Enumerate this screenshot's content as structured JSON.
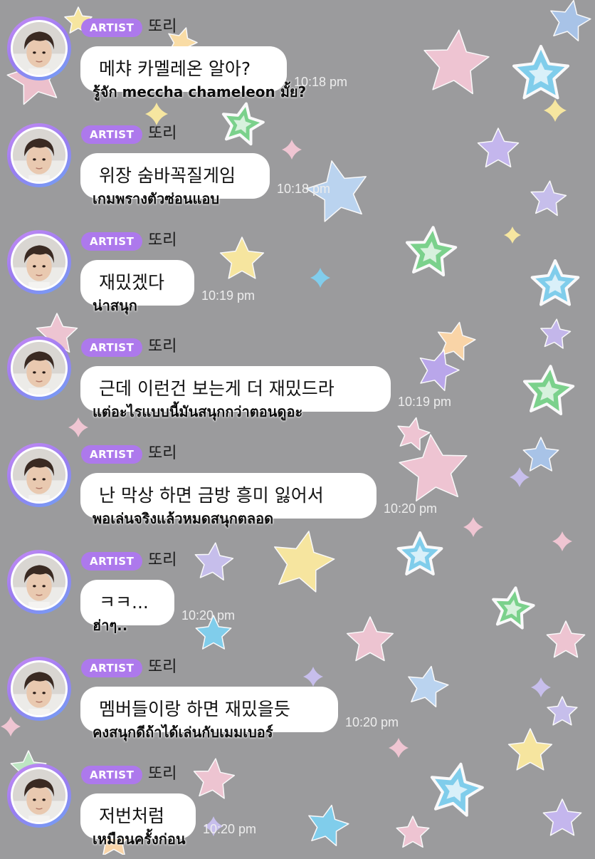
{
  "colors": {
    "background": "#9b9b9d",
    "badge": "#ad79ec",
    "bubble": "#ffffff"
  },
  "messages": [
    {
      "badge": "ARTIST",
      "sender": "또리",
      "text": "메챠 카멜레온 알아?",
      "time": "10:18 pm",
      "translation": "รู้จัก meccha chameleon มั้ย?"
    },
    {
      "badge": "ARTIST",
      "sender": "또리",
      "text": "위장 숨바꼭질게임",
      "time": "10:18 pm",
      "translation": "เกมพรางตัวซ่อนแอบ"
    },
    {
      "badge": "ARTIST",
      "sender": "또리",
      "text": "재밌겠다",
      "time": "10:19 pm",
      "translation": "น่าสนุก"
    },
    {
      "badge": "ARTIST",
      "sender": "또리",
      "text": "근데 이런건 보는게 더 재밌드라",
      "time": "10:19 pm",
      "translation": "แต่อะไรแบบนี้มันสนุกกว่าตอนดูอะ"
    },
    {
      "badge": "ARTIST",
      "sender": "또리",
      "text": "난 막상 하면 금방 흥미 잃어서",
      "time": "10:20 pm",
      "translation": "พอเล่นจริงแล้วหมดสนุกตลอด"
    },
    {
      "badge": "ARTIST",
      "sender": "또리",
      "text": "ㅋㅋ...",
      "time": "10:20 pm",
      "translation": "ฮ่าๆ.."
    },
    {
      "badge": "ARTIST",
      "sender": "또리",
      "text": "멤버들이랑 하면 재밌을듯",
      "time": "10:20 pm",
      "translation": "คงสนุกดีถ้าได้เล่นกับเมมเบอร์"
    },
    {
      "badge": "ARTIST",
      "sender": "또리",
      "text": "저번처럼",
      "time": "10:20 pm",
      "translation": "เหมือนครั้งก่อน"
    }
  ]
}
